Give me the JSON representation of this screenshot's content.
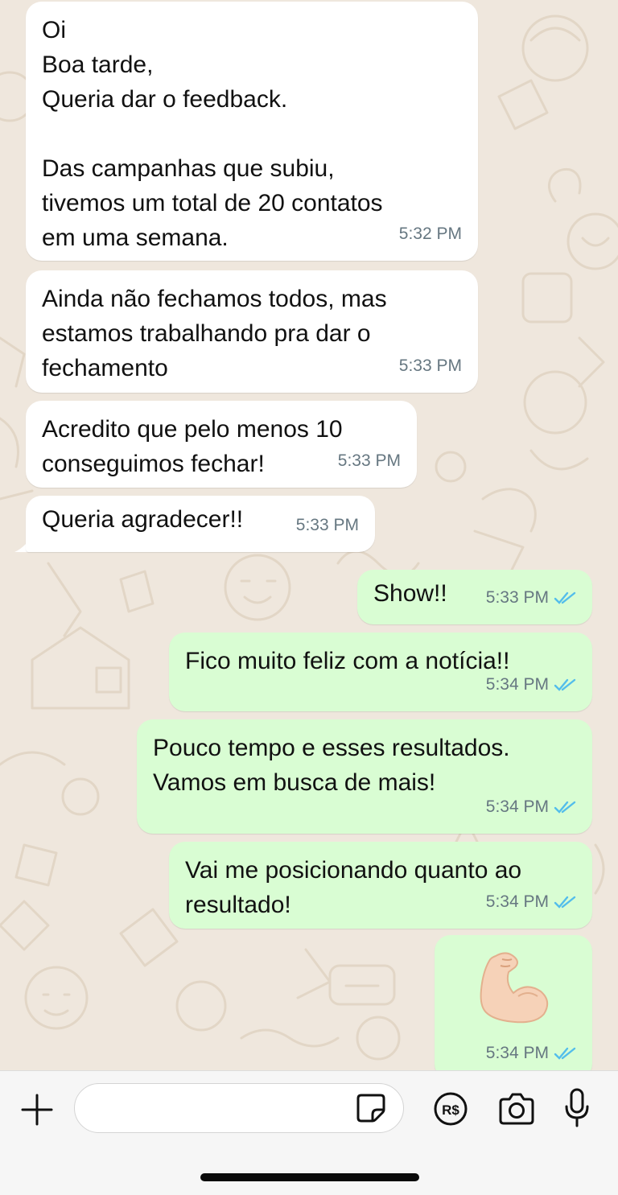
{
  "messages": [
    {
      "dir": "in",
      "text": "Oi\nBoa tarde,\nQueria dar o feedback.\n\nDas campanhas que subiu,\ntivemos um total de 20 contatos\nem uma semana.",
      "time": "5:32 PM"
    },
    {
      "dir": "in",
      "text": "Ainda não fechamos todos, mas\nestamos trabalhando pra dar o\nfechamento",
      "time": "5:33 PM"
    },
    {
      "dir": "in",
      "text": "Acredito que pelo menos 10\nconseguimos fechar!",
      "time": "5:33 PM"
    },
    {
      "dir": "in",
      "text": "Queria agradecer!!",
      "time": "5:33 PM"
    },
    {
      "dir": "out",
      "text": "Show!!",
      "time": "5:33 PM",
      "status": "read"
    },
    {
      "dir": "out",
      "text": "Fico muito feliz com a notícia!!",
      "time": "5:34 PM",
      "status": "read"
    },
    {
      "dir": "out",
      "text": "Pouco tempo e esses resultados.\nVamos em busca de mais!",
      "time": "5:34 PM",
      "status": "read"
    },
    {
      "dir": "out",
      "text": "Vai me posicionando quanto ao\nresultado!",
      "time": "5:34 PM",
      "status": "read"
    },
    {
      "dir": "out",
      "emoji": "flexed-biceps",
      "time": "5:34 PM",
      "status": "read"
    }
  ],
  "composer": {
    "input_value": "",
    "input_placeholder": "",
    "icons": [
      "plus-icon",
      "sticker-icon",
      "payment-icon",
      "camera-icon",
      "microphone-icon"
    ]
  },
  "colors": {
    "incoming_bubble": "#ffffff",
    "outgoing_bubble": "#d9fdd3",
    "read_ticks": "#53bdeb",
    "timestamp": "#667781",
    "wallpaper": "#efe7dd"
  }
}
